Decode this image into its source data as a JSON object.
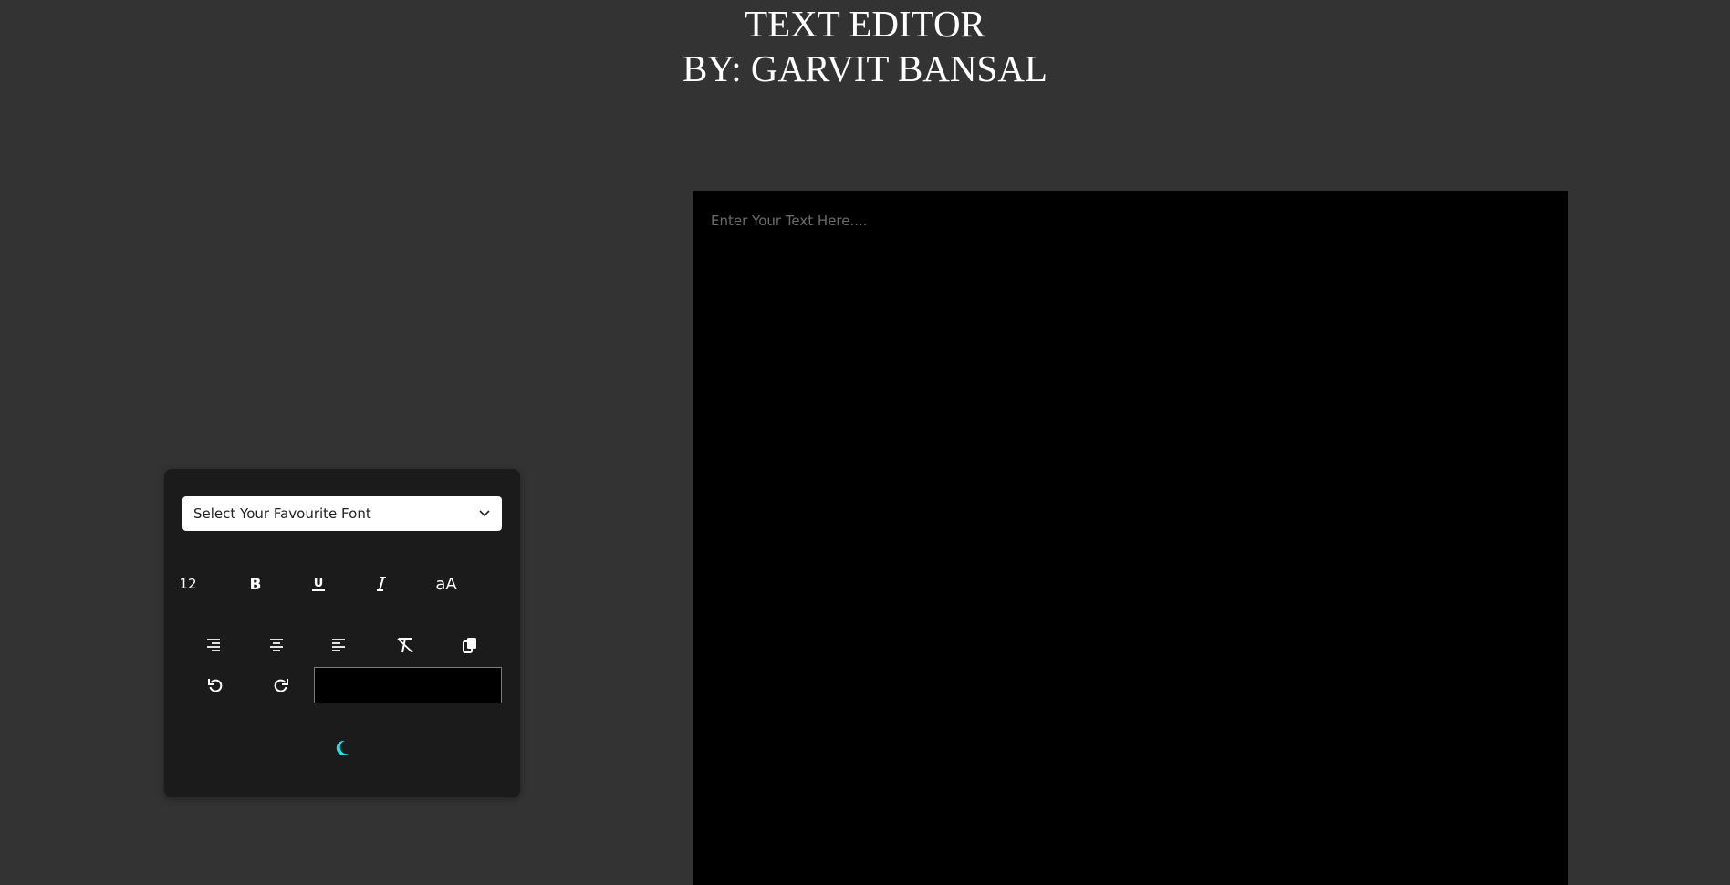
{
  "header": {
    "title_line1": "TEXT EDITOR",
    "title_line2": "BY: GARVIT BANSAL"
  },
  "editor": {
    "placeholder": "Enter Your Text Here....",
    "value": "",
    "background": "#000000"
  },
  "toolbox": {
    "font_select": {
      "selected": "Select Your Favourite Font",
      "icon": "chevron-down-icon"
    },
    "row1": {
      "font_size_label": "12",
      "bold_icon": "bold-icon",
      "underline_icon": "underline-icon",
      "italic_icon": "italic-icon",
      "case_label": "aA"
    },
    "row2": {
      "align_right_icon": "align-right-icon",
      "align_center_icon": "align-center-icon",
      "align_left_icon": "align-left-icon",
      "clear_format_icon": "clear-format-icon",
      "copy_icon": "copy-icon"
    },
    "row3": {
      "undo_icon": "undo-icon",
      "redo_icon": "redo-icon",
      "text_color_value": "#000000"
    },
    "theme_toggle_icon": "moon-icon",
    "theme_toggle_color": "#22e3e8"
  },
  "colors": {
    "page_background": "#333333",
    "toolbox_background": "#1b1b1b",
    "text": "#ffffff",
    "accent": "#22e3e8"
  }
}
